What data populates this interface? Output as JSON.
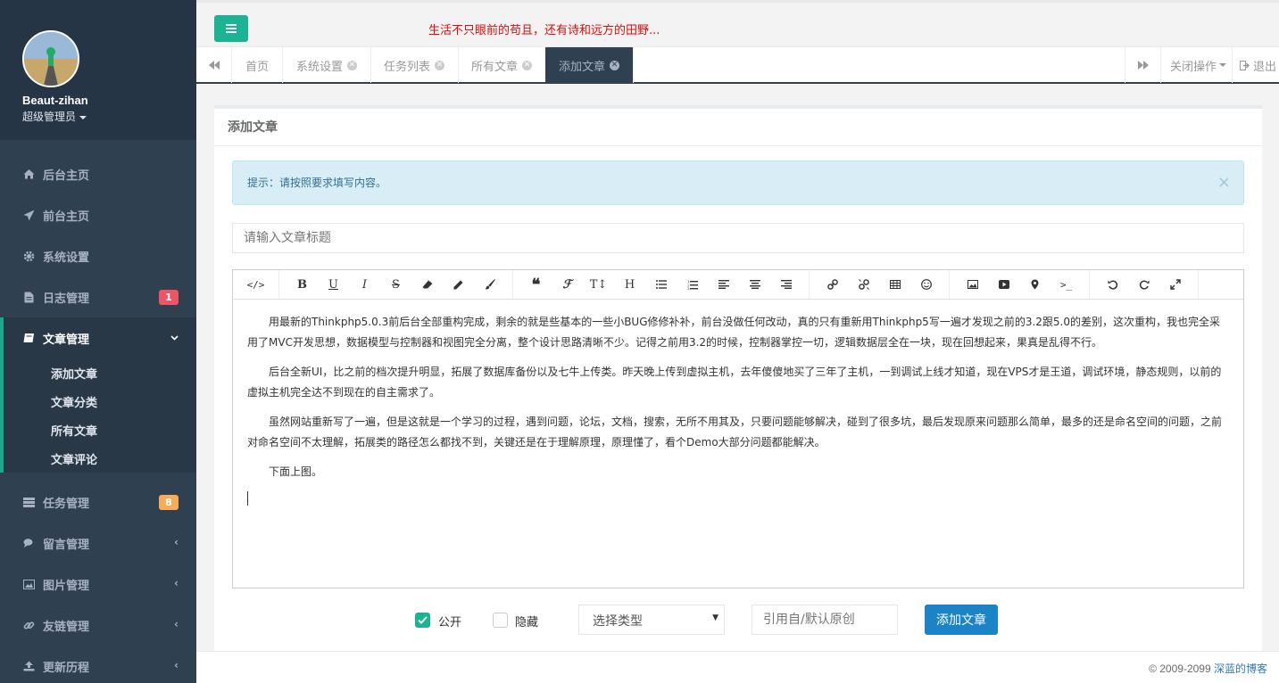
{
  "profile": {
    "name": "Beaut-zihan",
    "role": "超级管理员"
  },
  "sidebar": {
    "items": [
      {
        "label": "后台主页",
        "icon": "home-icon"
      },
      {
        "label": "前台主页",
        "icon": "send-icon"
      },
      {
        "label": "系统设置",
        "icon": "gear-icon"
      },
      {
        "label": "日志管理",
        "icon": "file-icon",
        "badge": "1",
        "badge_color": "#ed5565"
      },
      {
        "label": "文章管理",
        "icon": "book-icon",
        "expanded": true
      },
      {
        "label": "任务管理",
        "icon": "tasks-icon",
        "badge": "8",
        "badge_color": "#f8ac59"
      },
      {
        "label": "留言管理",
        "icon": "comments-icon"
      },
      {
        "label": "图片管理",
        "icon": "image-icon"
      },
      {
        "label": "友链管理",
        "icon": "link-icon"
      },
      {
        "label": "更新历程",
        "icon": "upload-icon"
      }
    ],
    "subitems": [
      "添加文章",
      "文章分类",
      "所有文章",
      "文章评论"
    ]
  },
  "header": {
    "slogan": "生活不只眼前的苟且，还有诗和远方的田野..."
  },
  "tabs": [
    {
      "label": "首页",
      "closable": false
    },
    {
      "label": "系统设置",
      "closable": true
    },
    {
      "label": "任务列表",
      "closable": true
    },
    {
      "label": "所有文章",
      "closable": true
    },
    {
      "label": "添加文章",
      "closable": true,
      "active": true
    }
  ],
  "tab_actions": {
    "close_ops": "关闭操作",
    "logout": "退出"
  },
  "panel": {
    "title": "添加文章",
    "alert": "提示：请按照要求填写内容。",
    "title_placeholder": "请输入文章标题"
  },
  "editor": {
    "paragraphs": [
      "用最新的Thinkphp5.0.3前后台全部重构完成，剩余的就是些基本的一些小BUG修修补补，前台没做任何改动，真的只有重新用Thinkphp5写一遍才发现之前的3.2跟5.0的差别，这次重构，我也完全采用了MVC开发思想，数据模型与控制器和视图完全分离，整个设计思路清晰不少。记得之前用3.2的时候，控制器掌控一切，逻辑数据层全在一块，现在回想起来，果真是乱得不行。",
      "后台全新UI，比之前的档次提升明显，拓展了数据库备份以及七牛上传类。昨天晚上传到虚拟主机，去年傻傻地买了三年了主机，一到调试上线才知道，现在VPS才是王道，调试环境，静态规则，以前的虚拟主机完全达不到现在的自主需求了。",
      "虽然网站重新写了一遍，但是这就是一个学习的过程，遇到问题，论坛，文档，搜索，无所不用其及，只要问题能够解决，碰到了很多坑，最后发现原来问题那么简单，最多的还是命名空间的问题，之前对命名空间不太理解，拓展类的路径怎么都找不到，关键还是在于理解原理，原理懂了，看个Demo大部分问题都能解决。",
      "下面上图。"
    ],
    "toolbar_groups": [
      [
        "code-view-icon"
      ],
      [
        "bold-icon",
        "underline-icon",
        "italic-icon",
        "strikethrough-icon",
        "eraser-icon",
        "pencil-icon",
        "brush-icon"
      ],
      [
        "quote-icon",
        "font-icon",
        "text-height-icon",
        "header-icon",
        "list-ul-icon",
        "list-ol-icon",
        "align-left-icon",
        "align-center-icon",
        "align-right-icon"
      ],
      [
        "link-icon",
        "unlink-icon",
        "table-icon",
        "emoji-icon"
      ],
      [
        "picture-icon",
        "video-icon",
        "location-icon",
        "code-icon"
      ],
      [
        "undo-icon",
        "redo-icon",
        "fullscreen-icon"
      ]
    ]
  },
  "form": {
    "public_label": "公开",
    "public_checked": true,
    "hidden_label": "隐藏",
    "hidden_checked": false,
    "type_select": "选择类型",
    "origin_placeholder": "引用自/默认原创",
    "submit_label": "添加文章"
  },
  "footer": {
    "copyright": "© 2009-2099 ",
    "link": "深蓝的博客"
  }
}
